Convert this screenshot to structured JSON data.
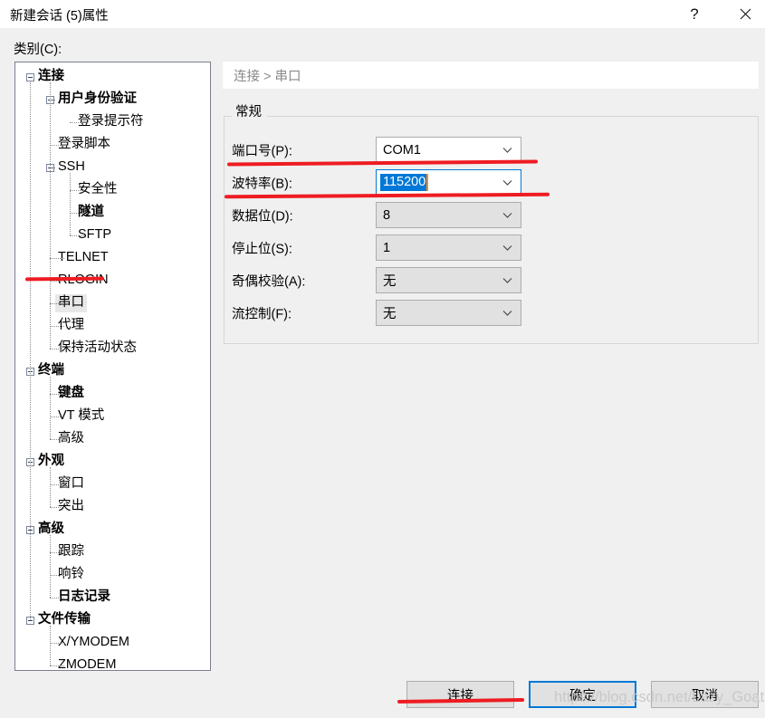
{
  "window": {
    "title": "新建会话 (5)属性",
    "help_icon": "question-mark-icon",
    "close_icon": "close-icon"
  },
  "category": {
    "label": "类别(C):",
    "tree": [
      {
        "label": "连接",
        "level": 0,
        "bold": true,
        "expander": true,
        "selected": false
      },
      {
        "label": "用户身份验证",
        "level": 1,
        "bold": true,
        "expander": true,
        "selected": false
      },
      {
        "label": "登录提示符",
        "level": 2,
        "bold": false,
        "expander": false,
        "selected": false
      },
      {
        "label": "登录脚本",
        "level": 1,
        "bold": false,
        "expander": false,
        "selected": false
      },
      {
        "label": "SSH",
        "level": 1,
        "bold": false,
        "expander": true,
        "selected": false
      },
      {
        "label": "安全性",
        "level": 2,
        "bold": false,
        "expander": false,
        "selected": false
      },
      {
        "label": "隧道",
        "level": 2,
        "bold": true,
        "expander": false,
        "selected": false
      },
      {
        "label": "SFTP",
        "level": 2,
        "bold": false,
        "expander": false,
        "selected": false
      },
      {
        "label": "TELNET",
        "level": 1,
        "bold": false,
        "expander": false,
        "selected": false
      },
      {
        "label": "RLOGIN",
        "level": 1,
        "bold": false,
        "expander": false,
        "selected": false
      },
      {
        "label": "串口",
        "level": 1,
        "bold": false,
        "expander": false,
        "selected": true
      },
      {
        "label": "代理",
        "level": 1,
        "bold": false,
        "expander": false,
        "selected": false
      },
      {
        "label": "保持活动状态",
        "level": 1,
        "bold": false,
        "expander": false,
        "selected": false
      },
      {
        "label": "终端",
        "level": 0,
        "bold": true,
        "expander": true,
        "selected": false
      },
      {
        "label": "键盘",
        "level": 1,
        "bold": true,
        "expander": false,
        "selected": false
      },
      {
        "label": "VT 模式",
        "level": 1,
        "bold": false,
        "expander": false,
        "selected": false
      },
      {
        "label": "高级",
        "level": 1,
        "bold": false,
        "expander": false,
        "selected": false
      },
      {
        "label": "外观",
        "level": 0,
        "bold": true,
        "expander": true,
        "selected": false
      },
      {
        "label": "窗口",
        "level": 1,
        "bold": false,
        "expander": false,
        "selected": false
      },
      {
        "label": "突出",
        "level": 1,
        "bold": false,
        "expander": false,
        "selected": false
      },
      {
        "label": "高级",
        "level": 0,
        "bold": true,
        "expander": true,
        "selected": false
      },
      {
        "label": "跟踪",
        "level": 1,
        "bold": false,
        "expander": false,
        "selected": false
      },
      {
        "label": "响铃",
        "level": 1,
        "bold": false,
        "expander": false,
        "selected": false
      },
      {
        "label": "日志记录",
        "level": 1,
        "bold": true,
        "expander": false,
        "selected": false
      },
      {
        "label": "文件传输",
        "level": 0,
        "bold": true,
        "expander": true,
        "selected": false
      },
      {
        "label": "X/YMODEM",
        "level": 1,
        "bold": false,
        "expander": false,
        "selected": false
      },
      {
        "label": "ZMODEM",
        "level": 1,
        "bold": false,
        "expander": false,
        "selected": false
      }
    ]
  },
  "panel": {
    "breadcrumb": "连接 > 串口",
    "group_title": "常规",
    "fields": [
      {
        "label": "端口号(P):",
        "value": "COM1",
        "state": "enabled",
        "arrow": "chevron-down-icon"
      },
      {
        "label": "波特率(B):",
        "value": "115200",
        "state": "focused",
        "arrow": "chevron-down-icon"
      },
      {
        "label": "数据位(D):",
        "value": "8",
        "state": "disabled",
        "arrow": "chevron-down-icon"
      },
      {
        "label": "停止位(S):",
        "value": "1",
        "state": "disabled",
        "arrow": "chevron-down-icon"
      },
      {
        "label": "奇偶校验(A):",
        "value": "无",
        "state": "disabled",
        "arrow": "chevron-down-icon"
      },
      {
        "label": "流控制(F):",
        "value": "无",
        "state": "disabled",
        "arrow": "chevron-down-icon"
      }
    ]
  },
  "buttons": {
    "connect": "连接",
    "ok": "确定",
    "cancel": "取消"
  },
  "watermark": "https://blog.csdn.net/Lazy_Goat",
  "colors": {
    "accent": "#0078d7",
    "annotation": "#ee1c22",
    "dialog_bg": "#f0f0f0",
    "field_disabled": "#e1e1e1"
  }
}
